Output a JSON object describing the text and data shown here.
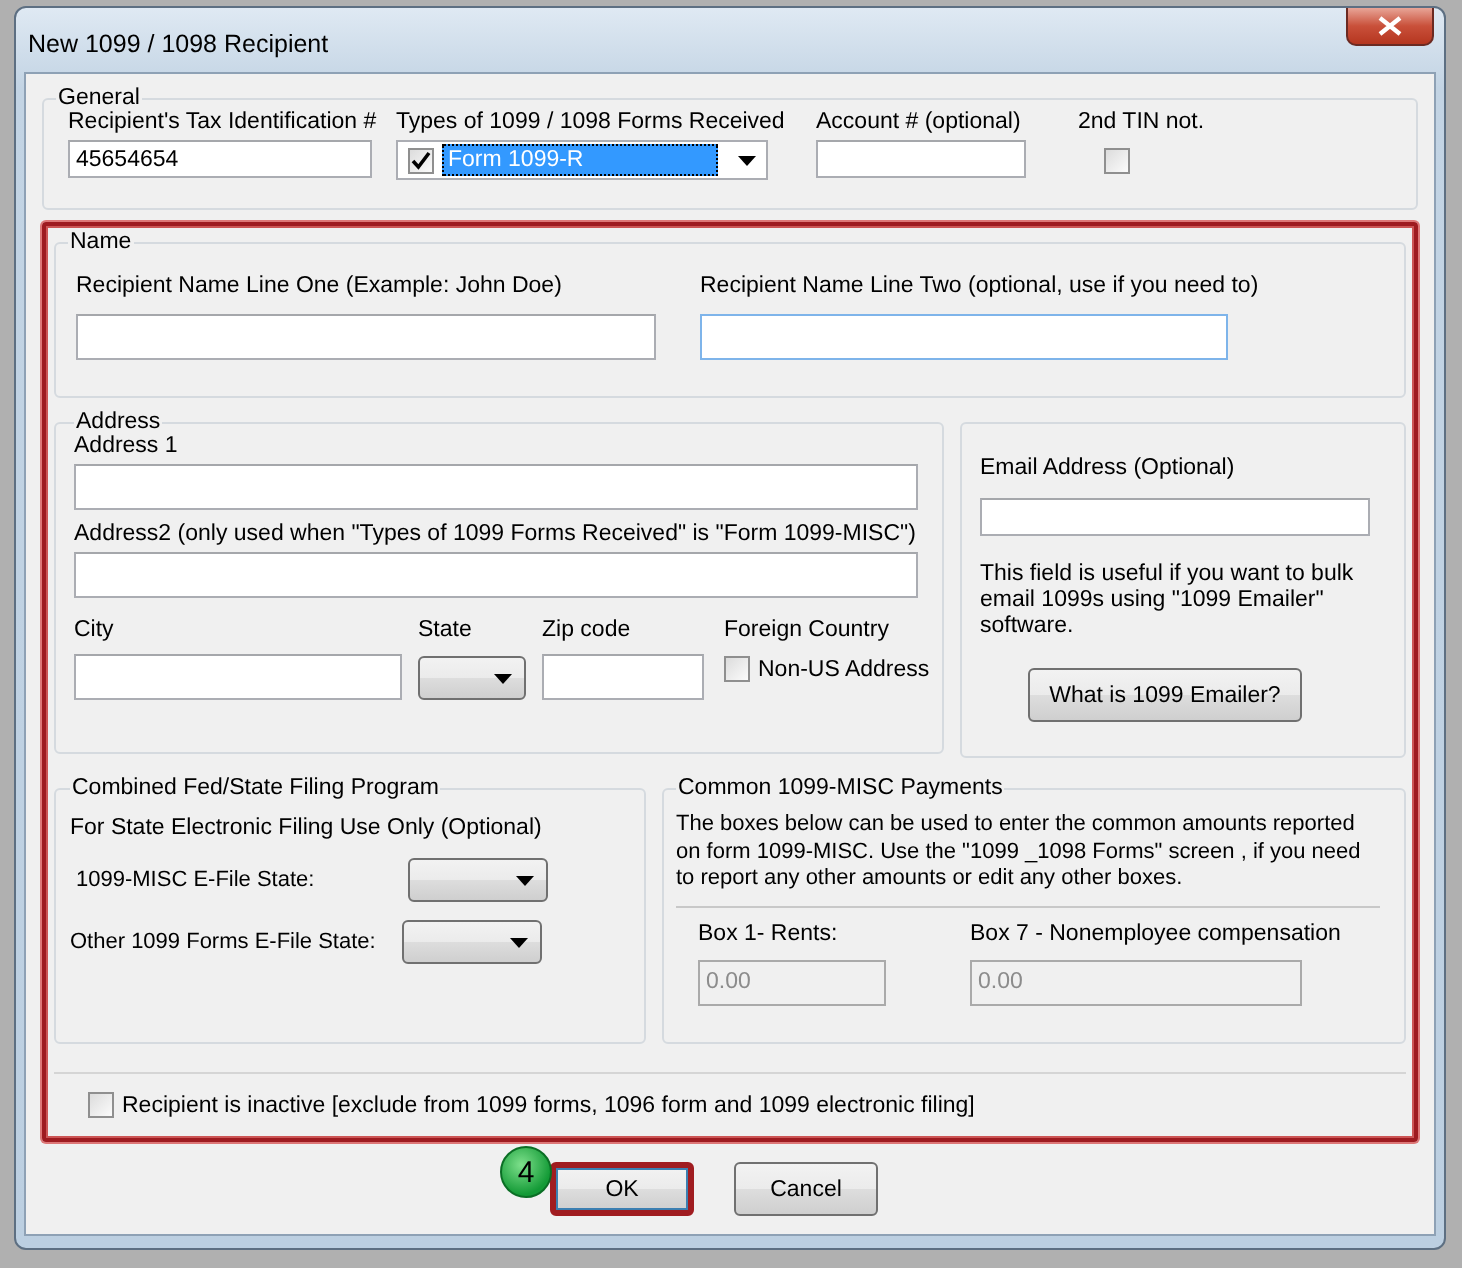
{
  "window": {
    "title": "New 1099 / 1098 Recipient"
  },
  "general": {
    "legend": "General",
    "tax_id": {
      "label": "Recipient's Tax Identification #",
      "value": "45654654"
    },
    "form_types": {
      "label": "Types of 1099 / 1098 Forms Received",
      "checked": true,
      "value": "Form 1099-R"
    },
    "account": {
      "label": "Account # (optional)"
    },
    "second_tin": {
      "label": "2nd TIN not.",
      "checked": false
    }
  },
  "name": {
    "legend": "Name",
    "line_one": {
      "label": "Recipient Name Line One (Example: John Doe)"
    },
    "line_two": {
      "label": "Recipient Name Line Two (optional, use if you need to)"
    }
  },
  "address": {
    "legend": "Address",
    "address1": {
      "label": "Address 1"
    },
    "address2": {
      "label": "Address2 (only used when \"Types of 1099 Forms Received\" is \"Form 1099-MISC\")"
    },
    "city": {
      "label": "City"
    },
    "state": {
      "label": "State"
    },
    "zip": {
      "label": "Zip code"
    },
    "foreign": {
      "label": "Foreign Country",
      "option": "Non-US Address",
      "checked": false
    }
  },
  "email": {
    "label": "Email Address (Optional)",
    "note": "This field is useful if you want to bulk email 1099s using \"1099 Emailer\" software.",
    "button": "What is 1099 Emailer?"
  },
  "state_filing": {
    "legend": "Combined Fed/State Filing Program",
    "note": "For State Electronic Filing Use Only (Optional)",
    "misc_label": "1099-MISC E-File State:",
    "other_label": "Other 1099 Forms E-File State:"
  },
  "payments": {
    "legend": "Common 1099-MISC Payments",
    "note": "The boxes below can be used to enter the common amounts reported on form 1099-MISC. Use the \"1099 _1098 Forms\" screen , if you need to report any other amounts or edit any other boxes.",
    "box1": {
      "label": "Box 1- Rents:",
      "value": "0.00"
    },
    "box7": {
      "label": "Box 7 - Nonemployee compensation",
      "value": "0.00"
    }
  },
  "inactive": {
    "label": "Recipient is inactive [exclude from 1099 forms, 1096 form and 1099 electronic filing]",
    "checked": false
  },
  "step_badge": "4",
  "buttons": [
    "OK",
    "Cancel"
  ]
}
